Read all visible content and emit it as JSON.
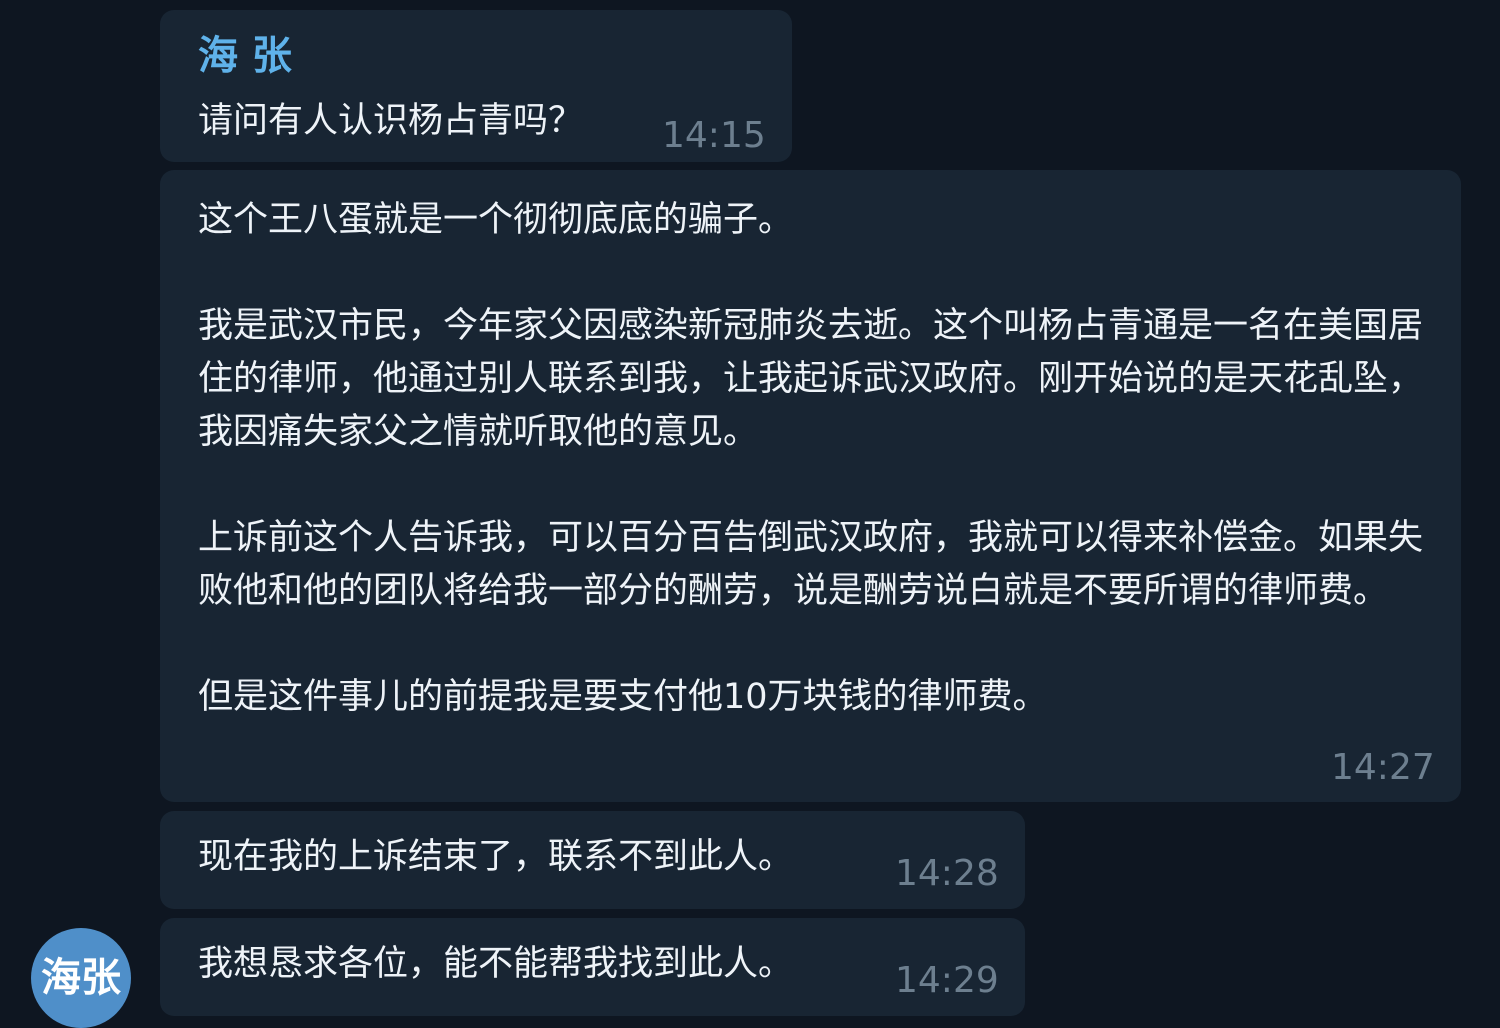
{
  "sender": {
    "name": "海 张",
    "avatar_text": "海张",
    "avatar_color": "#4f8fc9",
    "name_color": "#5fb2ea"
  },
  "theme": {
    "background": "#0e1621",
    "bubble": "#182533",
    "time_color": "#6d7f8f"
  },
  "messages": [
    {
      "text": "请问有人认识杨占青吗？",
      "time": "14:15"
    },
    {
      "text": "这个王八蛋就是一个彻彻底底的骗子。\n\n我是武汉市民，今年家父因感染新冠肺炎去逝。这个叫杨占青通是一名在美国居住的律师，他通过别人联系到我，让我起诉武汉政府。刚开始说的是天花乱坠，我因痛失家父之情就听取他的意见。\n\n上诉前这个人告诉我，可以百分百告倒武汉政府，我就可以得来补偿金。如果失败他和他的团队将给我一部分的酬劳，说是酬劳说白就是不要所谓的律师费。\n\n但是这件事儿的前提我是要支付他10万块钱的律师费。",
      "time": "14:27"
    },
    {
      "text": "现在我的上诉结束了，联系不到此人。",
      "time": "14:28"
    },
    {
      "text": "我想恳求各位，能不能帮我找到此人。",
      "time": "14:29"
    }
  ]
}
